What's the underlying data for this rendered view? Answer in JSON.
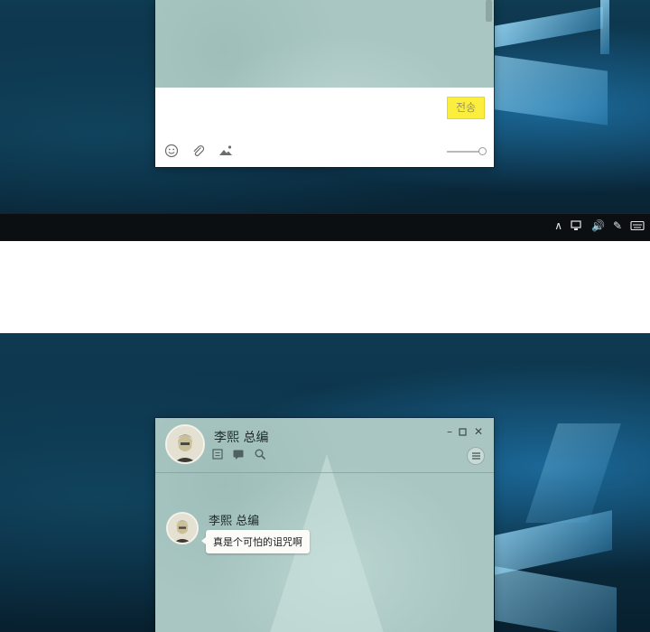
{
  "top_window": {
    "send_button_label": "전송",
    "tools": [
      "emoji-icon",
      "attachment-icon",
      "image-icon"
    ]
  },
  "taskbar": {
    "tray_icons": [
      "chevron-up-icon",
      "network-icon",
      "volume-icon",
      "pen-icon",
      "keyboard-icon"
    ]
  },
  "chat_window": {
    "contact_name": "李熙  总编",
    "window_controls": [
      "minimize-icon",
      "maximize-icon",
      "close-icon"
    ],
    "header_tools": [
      "notes-icon",
      "chat-icon",
      "search-icon"
    ]
  },
  "messages": [
    {
      "sender": "李熙  总编",
      "text": "真是个可怕的诅咒啊"
    }
  ],
  "colors": {
    "send_button": "#fbee3d",
    "window_bg": "#a9c6c2",
    "desktop": "#0e3a52"
  }
}
